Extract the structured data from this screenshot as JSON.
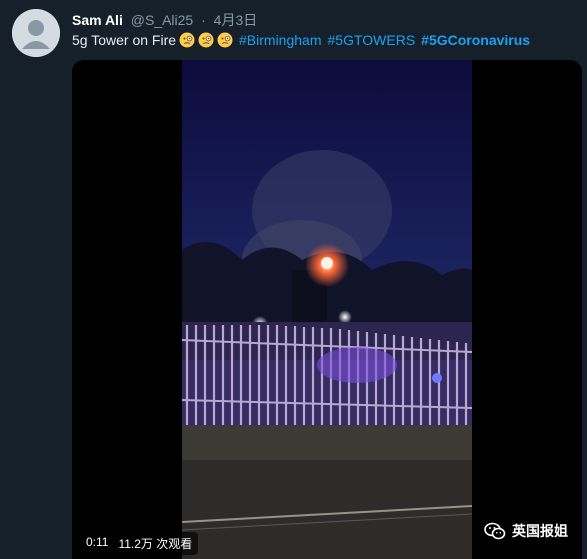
{
  "tweet": {
    "author_name": "Sam Ali",
    "handle": "@S_Ali25",
    "separator": "·",
    "date": "4月3日",
    "text": "5g Tower on Fire",
    "emoji_count": 3,
    "hashtags": [
      "#Birmingham",
      "#5GTOWERS",
      "#5GCoronavirus"
    ]
  },
  "video": {
    "time": "0:11",
    "views": "11.2万 次观看"
  },
  "watermark": {
    "label": "英国报姐"
  },
  "colors": {
    "background": "#15202b",
    "link": "#1da1f2",
    "muted": "#8899a6"
  }
}
